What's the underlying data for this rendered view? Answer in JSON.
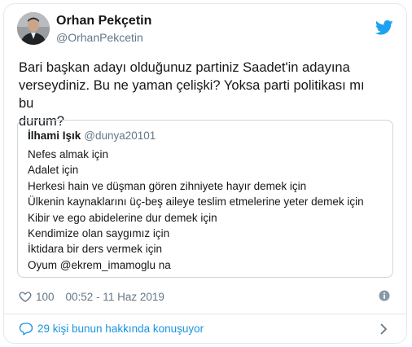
{
  "author": {
    "name": "Orhan Pekçetin",
    "handle": "@OrhanPekcetin"
  },
  "icons": {
    "brand": "twitter-bird-icon",
    "like": "heart-icon",
    "info": "info-icon",
    "conversation": "speech-bubble-icon",
    "next": "chevron-right-icon"
  },
  "colors": {
    "twitter_blue": "#1da1f2",
    "link_blue": "#1b95e0",
    "text": "#14171a",
    "secondary": "#657786",
    "border": "#e1e8ed"
  },
  "tweet": {
    "lines": [
      "Bari başkan adayı olduğunuz partiniz Saadet'in adayına",
      "verseydiniz. Bu ne yaman çelişki? Yoksa parti politikası mı bu",
      "durum?"
    ]
  },
  "quote": {
    "name": "İlhami Işık",
    "handle": "@dunya20101",
    "lines": [
      "Nefes almak için",
      "Adalet için",
      "Herkesi hain ve düşman gören zihniyete hayır demek için",
      "Ülkenin kaynaklarını üç-beş aileye teslim etmelerine yeter demek için",
      "Kibir ve ego abidelerine dur demek için",
      "Kendimize olan saygımız için",
      "İktidara bir ders vermek için",
      "Oyum @ekrem_imamoglu na"
    ]
  },
  "meta": {
    "likes": "100",
    "timestamp": "00:52 - 11 Haz 2019"
  },
  "conversation": {
    "label": "29 kişi bunun hakkında konuşuyor"
  }
}
